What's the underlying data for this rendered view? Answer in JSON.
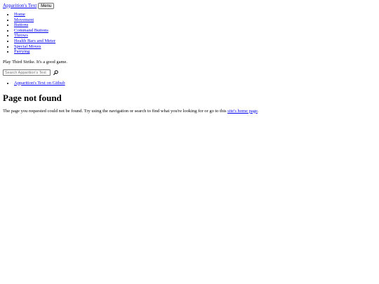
{
  "header": {
    "site_title": "Apparition's Text",
    "menu_label": "Menu"
  },
  "nav": {
    "items": [
      {
        "label": "Home"
      },
      {
        "label": "Movement"
      },
      {
        "label": "Buttons"
      },
      {
        "label": "Command Buttons"
      },
      {
        "label": "Throws"
      },
      {
        "label": "Health Bars and Meter"
      },
      {
        "label": "Special Moves"
      },
      {
        "label": "Parrying"
      }
    ]
  },
  "tagline": "Play Third Strike. It's a good game.",
  "search": {
    "placeholder": "Search Apparition's Text",
    "value": "",
    "icon": "search-icon"
  },
  "aux_links": {
    "items": [
      {
        "label": "Apparition's Text on Github"
      }
    ]
  },
  "main": {
    "title": "Page not found",
    "message_before_link": "The page you requested could not be found. Try using the navigation or search to find what you're looking for or go to this ",
    "home_link_label": "site's home page",
    "message_after_link": "."
  },
  "colors": {
    "link": "#0000ee",
    "text": "#000000",
    "background": "#ffffff"
  }
}
